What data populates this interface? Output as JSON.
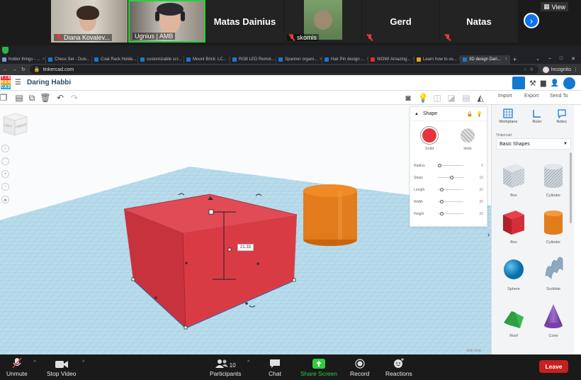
{
  "zoom_gallery": {
    "participants": [
      {
        "name": "Diana Kovalev..."
      },
      {
        "name": "Ugnius | AMB"
      },
      {
        "name": "Matas Dainius"
      },
      {
        "name": "skomis"
      },
      {
        "name": "Gerd"
      },
      {
        "name": "Natas"
      }
    ],
    "view_label": "View"
  },
  "browser": {
    "tabs": [
      {
        "label": "holder things - ..."
      },
      {
        "label": "Chess Set - Duiv..."
      },
      {
        "label": "Coat Rack Holde..."
      },
      {
        "label": "customizable scr..."
      },
      {
        "label": "Mount Brick: LC..."
      },
      {
        "label": "RGB LED Remot..."
      },
      {
        "label": "Spanner organi..."
      },
      {
        "label": "Hair Pin design ..."
      },
      {
        "label": "WOW! Amazing..."
      },
      {
        "label": "Learn how to us..."
      },
      {
        "label": "3D design Dari..."
      }
    ],
    "url": "tinkercad.com",
    "incognito_label": "Incognito"
  },
  "tinkercad": {
    "design_title": "Daring Habbi",
    "logo_letters": [
      "T",
      "I",
      "N",
      "K",
      "E",
      "R",
      "C",
      "A",
      "D"
    ],
    "toolbar_actions": {
      "import": "Import",
      "export": "Export",
      "send_to": "Send To"
    },
    "view_cube": {
      "left": "LEFT",
      "front": "FRONT"
    },
    "dimension_label": "21.33",
    "edit_grid_label": "Edit Grid",
    "shape_panel": {
      "title": "Shape",
      "solid_label": "Solid",
      "hole_label": "Hole",
      "solid_color": "#e8333f",
      "parameters": [
        {
          "label": "Radius",
          "value": "0",
          "position": 0.0
        },
        {
          "label": "Steps",
          "value": "10",
          "position": 0.55
        },
        {
          "label": "Length",
          "value": "20",
          "position": 0.1
        },
        {
          "label": "Width",
          "value": "20",
          "position": 0.1
        },
        {
          "label": "Height",
          "value": "20",
          "position": 0.1
        }
      ]
    },
    "side_tools": [
      {
        "label": "Workplane"
      },
      {
        "label": "Ruler"
      },
      {
        "label": "Notes"
      }
    ],
    "library": {
      "source_label": "Tinkercad",
      "selected": "Basic Shapes"
    },
    "shapes": [
      {
        "label": "Box",
        "kind": "box-hole"
      },
      {
        "label": "Cylinder",
        "kind": "cylinder-hole"
      },
      {
        "label": "Box",
        "kind": "box-red"
      },
      {
        "label": "Cylinder",
        "kind": "cylinder-orange"
      },
      {
        "label": "Sphere",
        "kind": "sphere"
      },
      {
        "label": "Scribble",
        "kind": "scribble"
      },
      {
        "label": "Roof",
        "kind": "roof"
      },
      {
        "label": "Cone",
        "kind": "cone"
      }
    ]
  },
  "zoom_controls": {
    "unmute": "Unmute",
    "stop_video": "Stop Video",
    "participants": "Participants",
    "participant_count": "10",
    "chat": "Chat",
    "share_screen": "Share Screen",
    "record": "Record",
    "reactions": "Reactions",
    "leave": "Leave"
  }
}
